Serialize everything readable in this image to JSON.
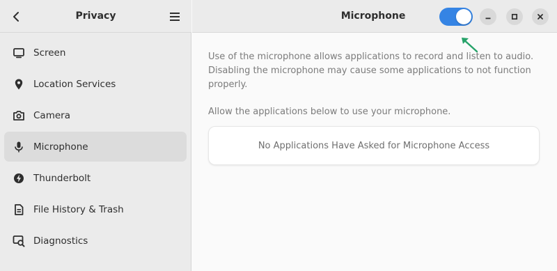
{
  "sidebar": {
    "title": "Privacy",
    "items": [
      {
        "label": "Screen",
        "icon": "screen-icon"
      },
      {
        "label": "Location Services",
        "icon": "location-pin-icon"
      },
      {
        "label": "Camera",
        "icon": "camera-icon"
      },
      {
        "label": "Microphone",
        "icon": "microphone-icon",
        "active": true
      },
      {
        "label": "Thunderbolt",
        "icon": "thunderbolt-icon"
      },
      {
        "label": "File History & Trash",
        "icon": "file-history-icon"
      },
      {
        "label": "Diagnostics",
        "icon": "diagnostics-icon"
      }
    ]
  },
  "main": {
    "title": "Microphone",
    "toggle_enabled": true,
    "description": "Use of the microphone allows applications to record and listen to audio. Disabling the microphone may cause some applications to not function properly.",
    "allow_text": "Allow the applications below to use your microphone.",
    "empty_state": "No Applications Have Asked for Microphone Access"
  },
  "colors": {
    "accent": "#3584e4",
    "annotation_arrow": "#26a269"
  }
}
